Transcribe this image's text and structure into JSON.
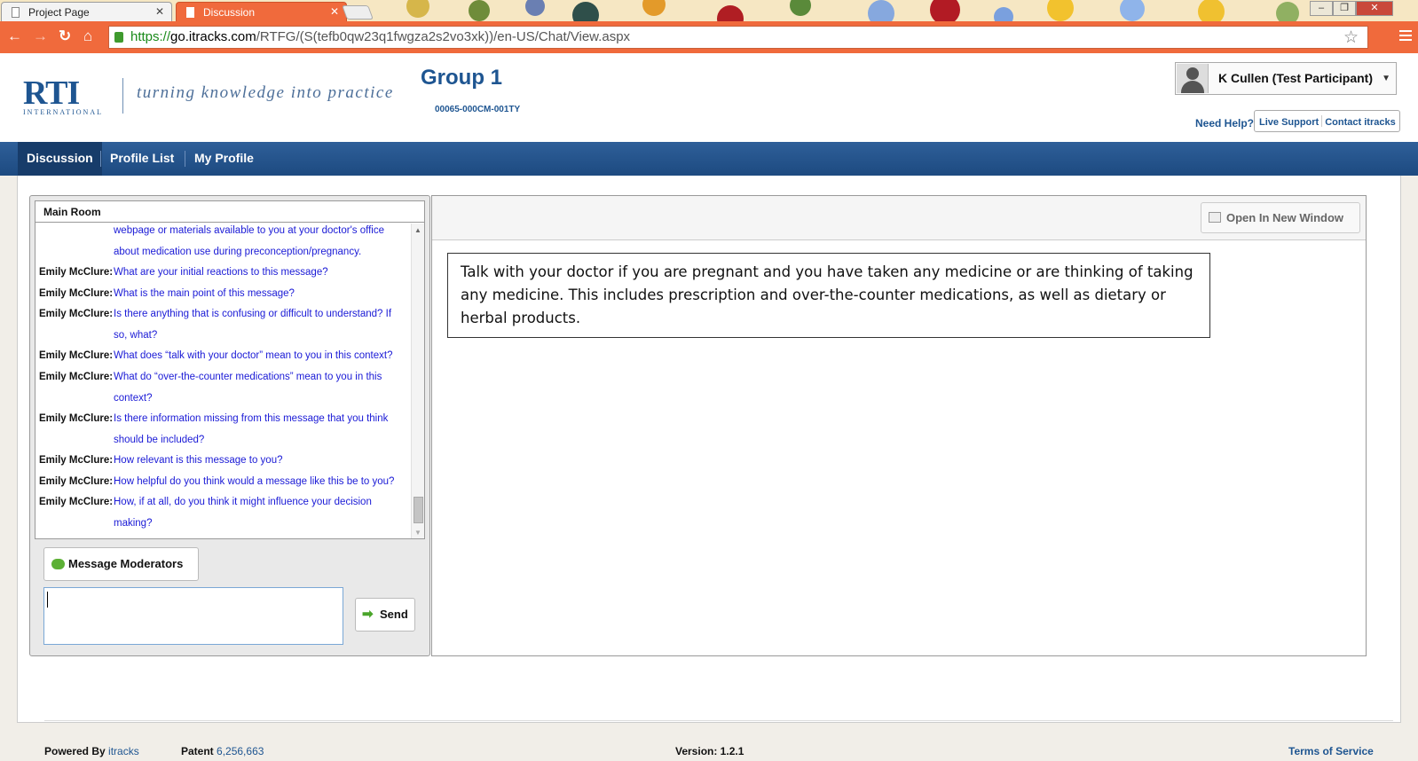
{
  "browser": {
    "tabs": [
      {
        "label": "Project Page",
        "active": false
      },
      {
        "label": "Discussion",
        "active": true
      }
    ],
    "url": {
      "protocol": "https://",
      "host": "go.itracks.com",
      "path": "/RTFG/(S(tefb0qw23q1fwgza2s2vo3xk))/en-US/Chat/View.aspx"
    },
    "accent_color": "#f06a3c"
  },
  "header": {
    "logo_text": "RTI",
    "logo_subtext": "INTERNATIONAL",
    "tagline": "turning knowledge into practice",
    "group_title": "Group 1",
    "group_code": "00065-000CM-001TY",
    "user_name": "K Cullen (Test Participant)",
    "need_help": "Need Help?",
    "live_support": "Live Support",
    "contact": "Contact itracks"
  },
  "nav": {
    "items": [
      {
        "label": "Discussion",
        "active": true
      },
      {
        "label": "Profile List",
        "active": false
      },
      {
        "label": "My Profile",
        "active": false
      }
    ]
  },
  "chat": {
    "room_title": "Main Room",
    "messages": [
      {
        "who": "",
        "text": "webpage or materials available to you at your doctor's office about medication use during preconception/pregnancy."
      },
      {
        "who": "Emily McClure:",
        "text": "What are your initial reactions to this message?"
      },
      {
        "who": "Emily McClure:",
        "text": "What is the main point of this message?"
      },
      {
        "who": "Emily McClure:",
        "text": "Is there anything that is confusing or difficult to understand? If so, what?"
      },
      {
        "who": "Emily McClure:",
        "text": "What does “talk with your doctor” mean to you in this context?"
      },
      {
        "who": "Emily McClure:",
        "text": "What do “over-the-counter medications” mean to you in this context?"
      },
      {
        "who": "Emily McClure:",
        "text": "Is there information missing from this message that you think should be included?"
      },
      {
        "who": "Emily McClure:",
        "text": "How relevant is this message to you?"
      },
      {
        "who": "Emily McClure:",
        "text": "How helpful do you think would a message like this be to you?"
      },
      {
        "who": "Emily McClure:",
        "text": "How, if at all, do you think it might influence your decision making?"
      }
    ],
    "message_moderators_label": "Message Moderators",
    "input_value": "",
    "send_label": "Send"
  },
  "display": {
    "open_new_window_label": "Open In New Window",
    "message": "Talk with your doctor if you are pregnant and you have taken any medicine or are thinking of taking any medicine. This includes prescription and over-the-counter medications, as well as dietary or herbal products."
  },
  "footer": {
    "powered_by_label": "Powered By",
    "powered_by_link": "itracks",
    "patent_label": "Patent",
    "patent_number": "6,256,663",
    "version_label": "Version: 1.2.1",
    "terms": "Terms of Service"
  },
  "colors": {
    "brand_blue": "#1e5591",
    "chat_text": "#1a1ad6",
    "nav_bg": "#2e5f99"
  }
}
